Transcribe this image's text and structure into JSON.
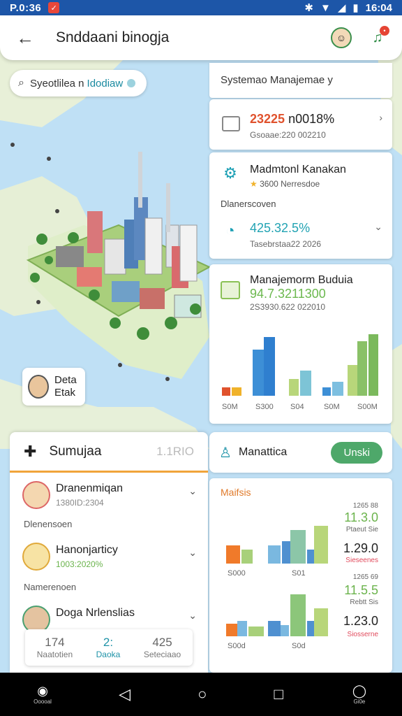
{
  "status_bar": {
    "time_left": "P.0:36",
    "time_right": "16:04"
  },
  "app_bar": {
    "title": "Snddaani binogja"
  },
  "search": {
    "term_a": "Syeotlilea n",
    "term_b": "Idodiaw"
  },
  "panel": {
    "header": "Systemao Manajemae y",
    "card1": {
      "price_hi": "23225",
      "price_lo": "n0018%",
      "sub": "Gsoaae:220 002210"
    },
    "card2": {
      "title": "Madmtonl Kanakan",
      "rating": "3600 Nerresdoe",
      "section": "Dlanerscoven",
      "value": "425.32.5%",
      "sub": "Tasebrstaa22 2026"
    },
    "card3": {
      "title": "Manajemorm Buduia",
      "value": "94.7.3211300",
      "sub": "2S3930.622 022010",
      "x_labels": [
        "S0M",
        "S300",
        "S04",
        "S0M",
        "S00M"
      ]
    }
  },
  "map_chip": {
    "line1": "Deta",
    "line2": "Etak"
  },
  "sheet": {
    "title": "Sumujaa",
    "tag": "1.1RIO",
    "people": [
      {
        "name": "Dranenmiqan",
        "sub": "1380ID:2304"
      },
      {
        "name": "Hanonjarticy",
        "sub": "1003:2020%"
      },
      {
        "name": "Doga Nrlenslias",
        "sub": ""
      }
    ],
    "section1": "Dlenensoen",
    "section2": "Namerenoen",
    "tabs": [
      {
        "icon": "174",
        "label": "Naatotien"
      },
      {
        "icon": "2:",
        "label": "Daoka"
      },
      {
        "icon": "425",
        "label": "Seteciaao"
      }
    ]
  },
  "right_bottom": {
    "nav_label": "Manattica",
    "button": "Unski",
    "stats_title": "Maifsis",
    "group1": {
      "small_top": "1265 88",
      "big1": "11.3.0",
      "label1": "Ptaeut Sie",
      "big2": "1.29.0",
      "label2": "Sieseenes"
    },
    "group2": {
      "small_top": "1265 69",
      "big1": "11.5.5",
      "label1": "Rebtt Sis",
      "big2": "1.23.0",
      "label2": "Siosserne"
    },
    "axis1": [
      "S000",
      "S01"
    ],
    "axis2": [
      "S00d",
      "S0d"
    ]
  },
  "sys_nav": {
    "app_label": "Ooooal",
    "right_label": "Gi0e"
  },
  "colors": {
    "accent_teal": "#22a3b3",
    "accent_green": "#4ea86a",
    "accent_orange": "#e0522d",
    "status_bar": "#1d56a8"
  }
}
